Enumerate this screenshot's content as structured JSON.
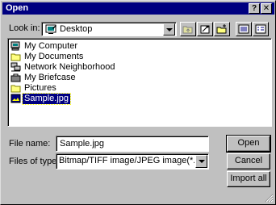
{
  "window": {
    "title": "Open",
    "help_label": "?",
    "close_label": "✕"
  },
  "lookin": {
    "label": "Look in:",
    "value": "Desktop"
  },
  "toolbar": {
    "buttons": [
      {
        "name": "up-one-level",
        "icon": "folder-up-icon"
      },
      {
        "name": "favorites",
        "icon": "favorites-icon"
      },
      {
        "name": "new-folder",
        "icon": "new-folder-icon"
      },
      {
        "name": "list-view",
        "icon": "list-view-icon"
      },
      {
        "name": "details-view",
        "icon": "details-view-icon"
      }
    ]
  },
  "files": [
    {
      "label": "My Computer",
      "icon": "computer-icon"
    },
    {
      "label": "My Documents",
      "icon": "folder-icon"
    },
    {
      "label": "Network Neighborhood",
      "icon": "network-icon"
    },
    {
      "label": "My Briefcase",
      "icon": "briefcase-icon"
    },
    {
      "label": "Pictures",
      "icon": "folder-icon"
    },
    {
      "label": "Sample.jpg",
      "icon": "image-file-icon",
      "selected": true
    }
  ],
  "filename": {
    "label": "File name:",
    "value": "Sample.jpg"
  },
  "filetype": {
    "label": "Files of type:",
    "value": "Bitmap/TIFF image/JPEG image(*.bmp;*tif;*.jp"
  },
  "buttons": {
    "open": "Open",
    "cancel": "Cancel",
    "import_all": "Import all"
  },
  "colors": {
    "titlebar": "#000080",
    "face": "#c0c0c0",
    "selection": "#000080"
  }
}
